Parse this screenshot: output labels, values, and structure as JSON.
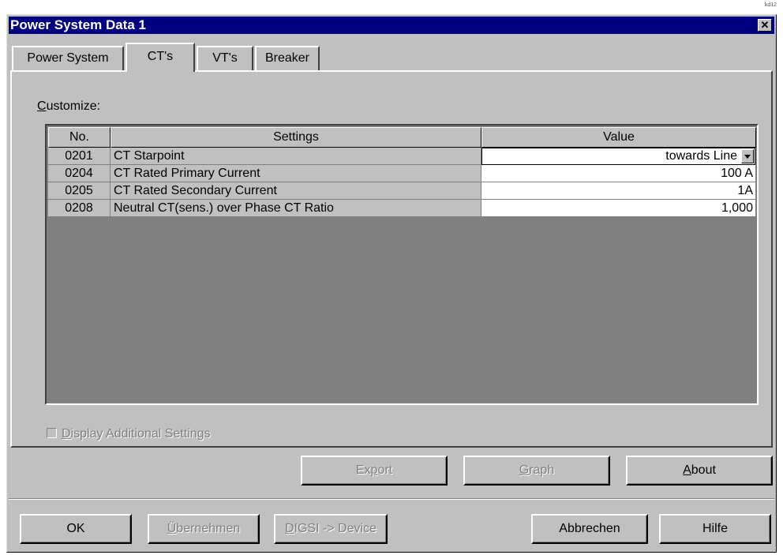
{
  "corner_mark": "kd12",
  "window": {
    "title": "Power System Data 1"
  },
  "tabs": [
    {
      "label": "Power System"
    },
    {
      "label": "CT's"
    },
    {
      "label": "VT's"
    },
    {
      "label": "Breaker"
    }
  ],
  "customize": {
    "label_first": "C",
    "label_rest": "ustomize:"
  },
  "grid": {
    "headers": {
      "no": "No.",
      "settings": "Settings",
      "value": "Value"
    },
    "rows": [
      {
        "no": "0201",
        "setting": "CT Starpoint",
        "value": "towards Line"
      },
      {
        "no": "0204",
        "setting": "CT Rated Primary Current",
        "value": "100 A"
      },
      {
        "no": "0205",
        "setting": "CT Rated Secondary Current",
        "value": "1A"
      },
      {
        "no": "0208",
        "setting": "Neutral CT(sens.) over Phase CT Ratio",
        "value": "1,000"
      }
    ]
  },
  "checkbox": {
    "label_first": "D",
    "label_rest": "isplay Additional Settings",
    "checked": false
  },
  "buttons": {
    "export": {
      "pre": "Ex",
      "u": "p",
      "post": "ort"
    },
    "graph": {
      "u": "G",
      "post": "raph"
    },
    "about": {
      "u": "A",
      "post": "bout"
    },
    "ok": "OK",
    "apply": {
      "u": "Ü",
      "post": "bernehmen"
    },
    "digsi": {
      "u": "D",
      "post": "IGSI -> Device"
    },
    "cancel": "Abbrechen",
    "help": "Hilfe"
  },
  "icons": {
    "close": "close-icon",
    "dropdown": "chevron-down-icon"
  }
}
